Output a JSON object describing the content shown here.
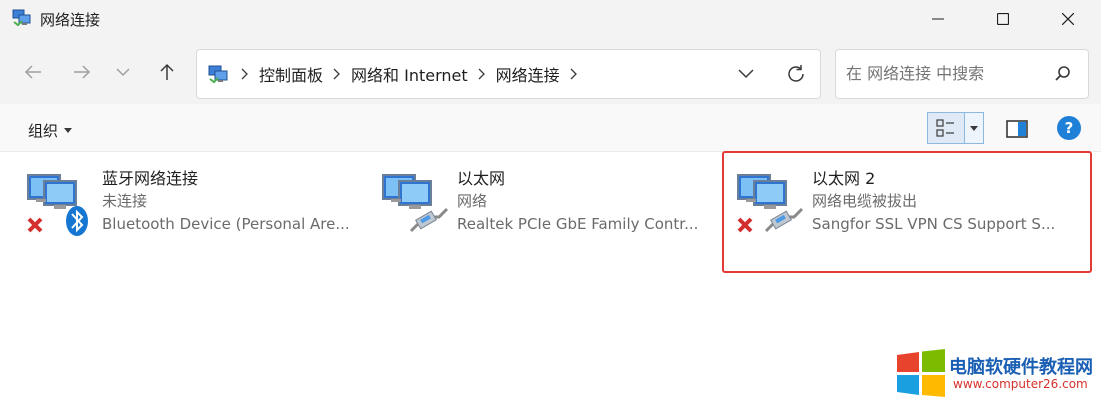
{
  "window": {
    "title": "网络连接"
  },
  "nav": {
    "breadcrumbs": [
      "控制面板",
      "网络和 Internet",
      "网络连接"
    ]
  },
  "search": {
    "placeholder": "在 网络连接 中搜索"
  },
  "toolbar": {
    "organize_label": "组织",
    "help_label": "?"
  },
  "connections": [
    {
      "name": "蓝牙网络连接",
      "status": "未连接",
      "device": "Bluetooth Device (Personal Are...",
      "icon": "bluetooth-network-icon",
      "disconnected": true
    },
    {
      "name": "以太网",
      "status": "网络",
      "device": "Realtek PCIe GbE Family Contr...",
      "icon": "ethernet-network-icon",
      "disconnected": false
    },
    {
      "name": "以太网 2",
      "status": "网络电缆被拔出",
      "device": "Sangfor SSL VPN CS Support S...",
      "icon": "ethernet-network-icon",
      "disconnected": true,
      "highlighted": true
    }
  ],
  "watermark": {
    "title": "电脑软硬件教程网",
    "url": "www.computer26.com"
  },
  "colors": {
    "accent": "#1e80d6",
    "highlight": "#e53935",
    "titlebar_bg": "#f3f3f3",
    "watermark_title": "#1a5fb4",
    "watermark_url": "#d6302b"
  }
}
